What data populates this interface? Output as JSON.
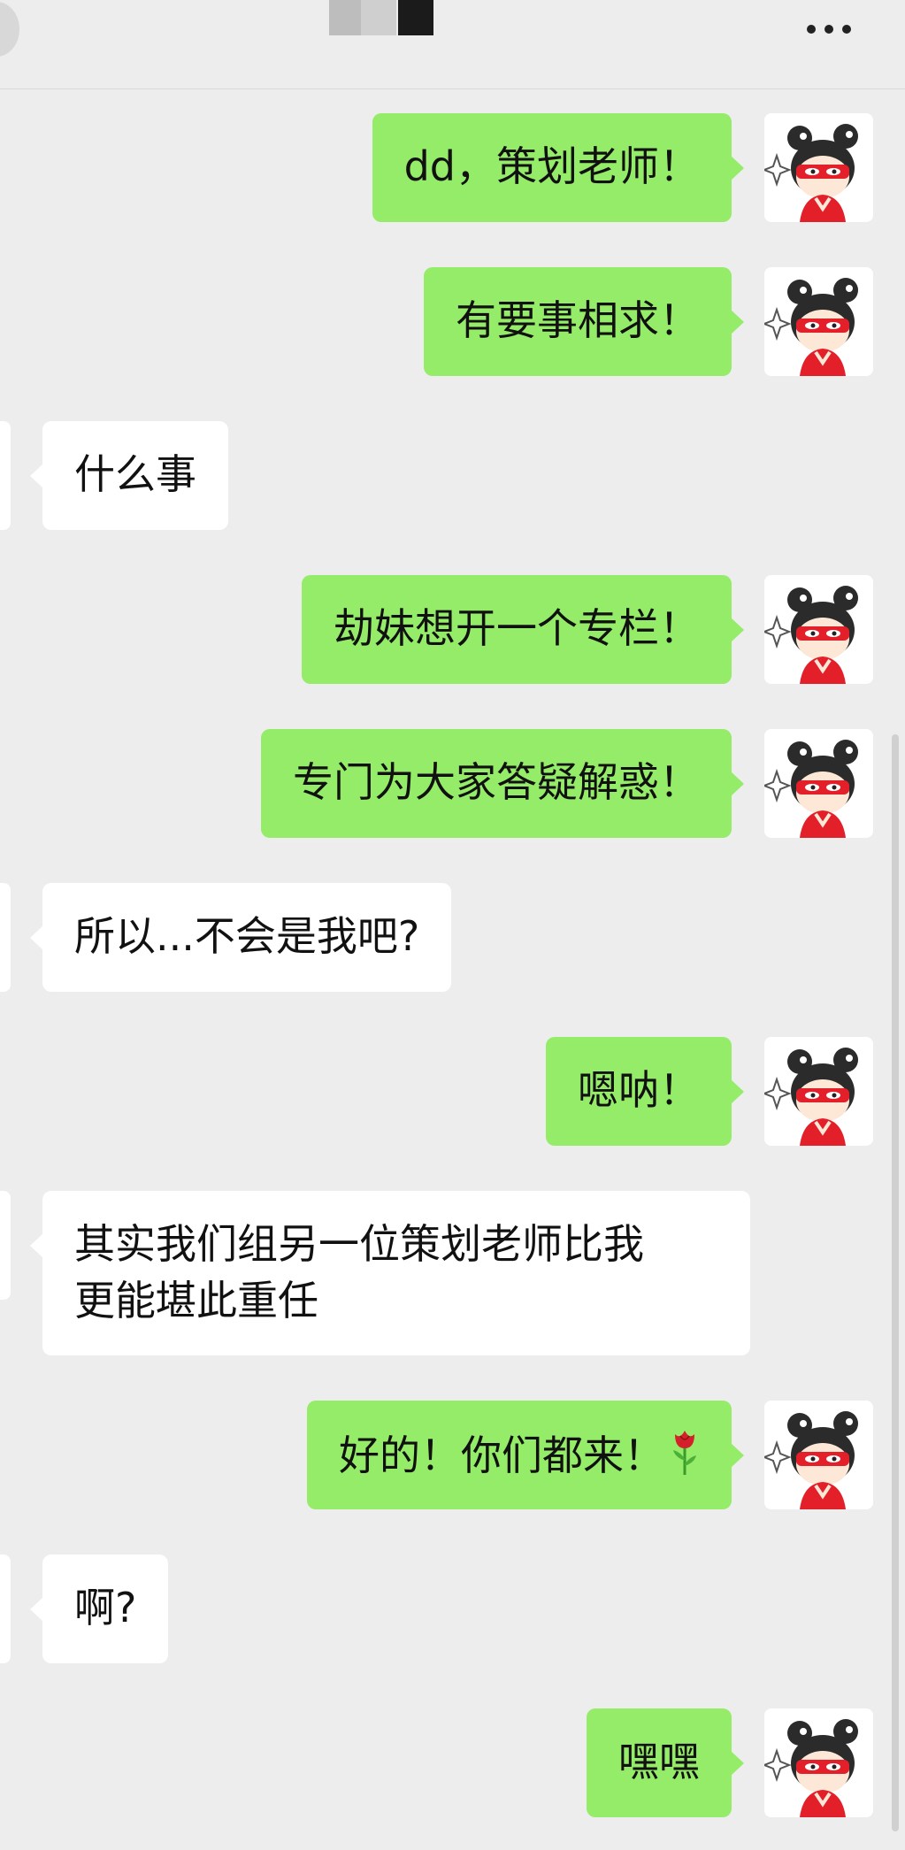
{
  "colors": {
    "sent_bubble": "#95ec69",
    "received_bubble": "#ffffff",
    "background": "#ededed"
  },
  "header": {
    "more_icon": "more-horizontal-icon"
  },
  "messages": [
    {
      "side": "sent",
      "text": "dd，策划老师！"
    },
    {
      "side": "sent",
      "text": "有要事相求！"
    },
    {
      "side": "received",
      "text": "什么事"
    },
    {
      "side": "sent",
      "text": "劫妹想开一个专栏！"
    },
    {
      "side": "sent",
      "text": "专门为大家答疑解惑！"
    },
    {
      "side": "received",
      "text": "所以...不会是我吧?"
    },
    {
      "side": "sent",
      "text": "嗯呐！"
    },
    {
      "side": "received",
      "line1": "其实我们组另一位策划老师比我",
      "line2": "更能堪此重任"
    },
    {
      "side": "sent",
      "text": "好的！你们都来！",
      "emoji": "rose-emoji"
    },
    {
      "side": "received",
      "text": "啊?"
    },
    {
      "side": "sent",
      "text": "嘿嘿"
    }
  ]
}
